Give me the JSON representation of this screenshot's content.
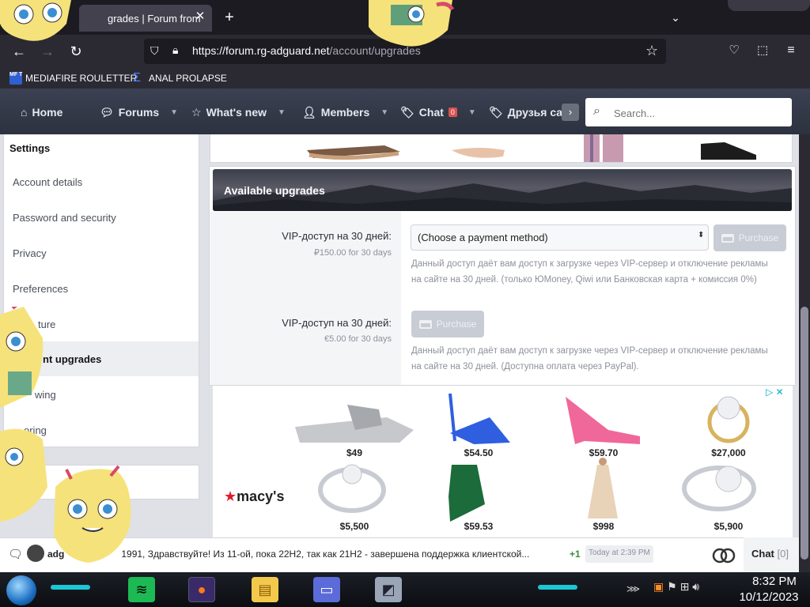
{
  "browser": {
    "tab_title": "grades | Forum from",
    "url_host": "https://forum.rg-adguard.net",
    "url_path": "/account/upgrades"
  },
  "bookmarks": [
    {
      "label": "MEDIAFIRE ROULETTER",
      "icon": "MF T"
    },
    {
      "label": "ANAL PROLAPSE",
      "icon": "sigma"
    }
  ],
  "forum_nav": {
    "home": "Home",
    "forums": "Forums",
    "whats_new": "What's new",
    "members": "Members",
    "chat": "Chat",
    "chat_badge": "0",
    "friends": "Друзья сай",
    "search_placeholder": "Search..."
  },
  "sidebar": {
    "heading": "Settings",
    "items": [
      {
        "label": "Account details"
      },
      {
        "label": "Password and security"
      },
      {
        "label": "Privacy"
      },
      {
        "label": "Preferences"
      },
      {
        "label": "ture"
      },
      {
        "label": "nt upgrades"
      },
      {
        "label": "wing"
      },
      {
        "label": "oring"
      }
    ]
  },
  "upgrades": {
    "title": "Available upgrades",
    "items": [
      {
        "label": "VIP-доступ на 30 дней:",
        "price": "₽150.00 for 30 days",
        "select_value": "(Choose a payment method)",
        "button": "Purchase",
        "desc_1": "Данный доступ даёт вам доступ к загрузке через VIP-сервер и отключение рекламы",
        "desc_2": "на сайте на 30 дней. (только ЮMoney, Qiwi или Банковская карта + комиссия 0%)"
      },
      {
        "label": "VIP-доступ на 30 дней:",
        "price": "€5.00 for 30 days",
        "button": "Purchase",
        "desc_1": "Данный доступ даёт вам доступ к загрузке через VIP-сервер и отключение рекламы",
        "desc_2": "на сайте на 30 дней. (Доступна оплата через PayPal)."
      }
    ]
  },
  "ad": {
    "brand": "macy's",
    "prices": [
      "$49",
      "$54.50",
      "$59.70",
      "$27,000",
      "$5,500",
      "$59.53",
      "$998",
      "$5,900"
    ]
  },
  "chat": {
    "user": "adg",
    "message": "1991, Здравствуйте! Из 11-ой, пока 22H2, так как 21H2 - завершена поддержка клиентской...",
    "plus": "+1",
    "time": "Today at 2:39 PM",
    "label": "Chat",
    "count": "[0]"
  },
  "taskbar": {
    "time": "8:32 PM",
    "date": "10/12/2023"
  },
  "colors": {
    "forum_nav_bg": "#3b4152",
    "badge": "#d9534f",
    "purchase_disabled": "#c8ccd4",
    "macys_star": "#e21a2c"
  }
}
